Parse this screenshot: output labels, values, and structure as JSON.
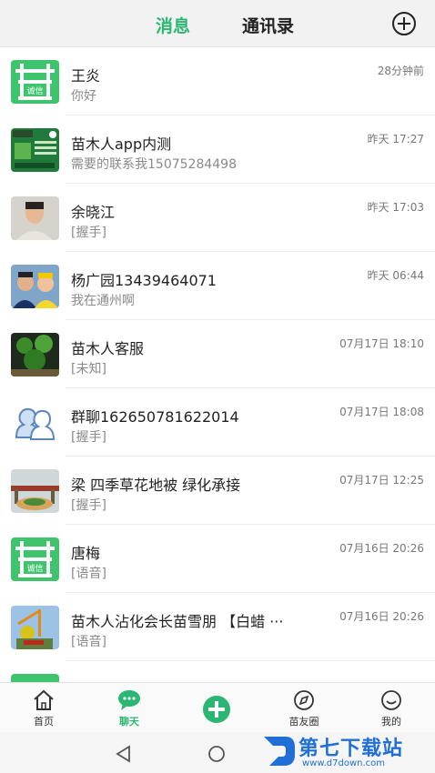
{
  "header": {
    "tab_active": "消息",
    "tab_contacts": "通讯录"
  },
  "logo_text": "诚信",
  "messages": [
    {
      "name": "王炎",
      "time": "28分钟前",
      "preview": "你好",
      "avatar": "logo"
    },
    {
      "name": "苗木人app内测",
      "time": "昨天 17:27",
      "preview": "需要的联系我15075284498",
      "avatar": "group-photo"
    },
    {
      "name": "余晓江",
      "time": "昨天 17:03",
      "preview": "[握手]",
      "avatar": "person"
    },
    {
      "name": "杨广园13439464071",
      "time": "昨天 06:44",
      "preview": "我在通州啊",
      "avatar": "couple"
    },
    {
      "name": "苗木人客服",
      "time": "07月17日 18:10",
      "preview": "[未知]",
      "avatar": "plants"
    },
    {
      "name": "群聊162650781622014",
      "time": "07月17日 18:08",
      "preview": "[握手]",
      "avatar": "group"
    },
    {
      "name": "梁 四季草花地被 绿化承接",
      "time": "07月17日 12:25",
      "preview": "[握手]",
      "avatar": "garden"
    },
    {
      "name": "唐梅",
      "time": "07月16日 20:26",
      "preview": "[语音]",
      "avatar": "logo"
    },
    {
      "name": "苗木人沾化会长苗雪朋 【白蜡 ···",
      "time": "07月16日 20:26",
      "preview": "[语音]",
      "avatar": "crane"
    }
  ],
  "nav": {
    "home": "首页",
    "chat": "聊天",
    "moments": "苗友圈",
    "mine": "我的"
  },
  "watermark": {
    "title": "第七下载站",
    "url": "www.d7down.com"
  },
  "colors": {
    "accent": "#2bb673",
    "header_bg": "#f2f2f2"
  }
}
